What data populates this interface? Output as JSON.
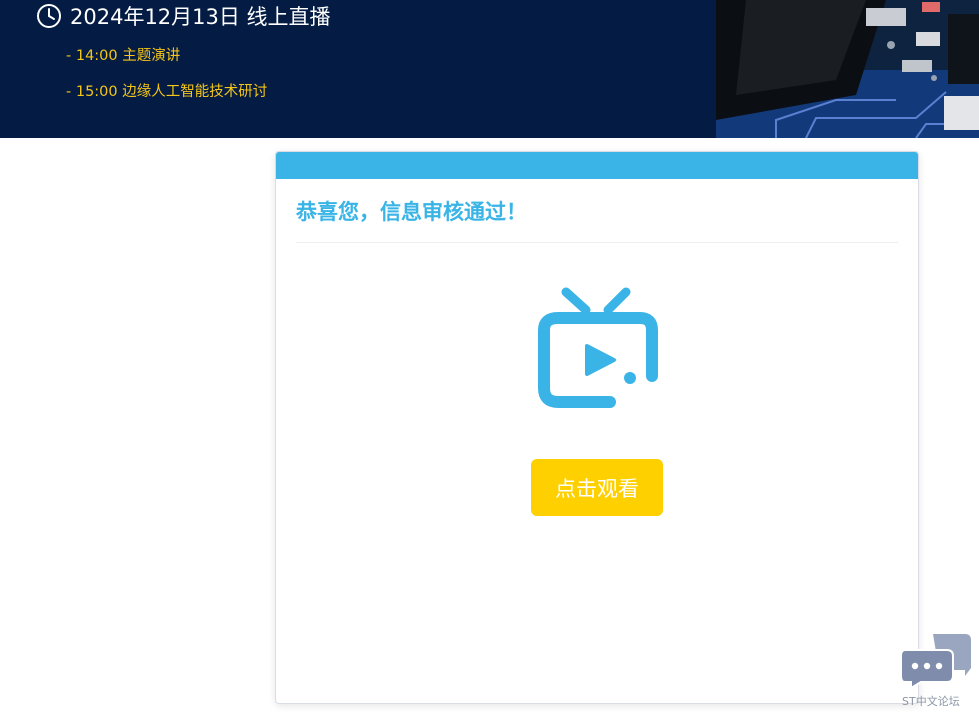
{
  "banner": {
    "date_line": "2024年12月13日 线上直播",
    "agenda": [
      "- 14:00 主题演讲",
      "- 15:00 边缘人工智能技术研讨"
    ],
    "clock_icon": "clock-icon",
    "background_color": "#041c44",
    "agenda_color": "#f5c518"
  },
  "card": {
    "title": "恭喜您，信息审核通过！",
    "header_color": "#3ab4e6",
    "icon": "tv-play-icon",
    "watch_button_label": "点击观看",
    "button_color": "#ffd000"
  },
  "forum": {
    "label": "ST中文论坛",
    "icon": "chat-bubbles-icon"
  }
}
